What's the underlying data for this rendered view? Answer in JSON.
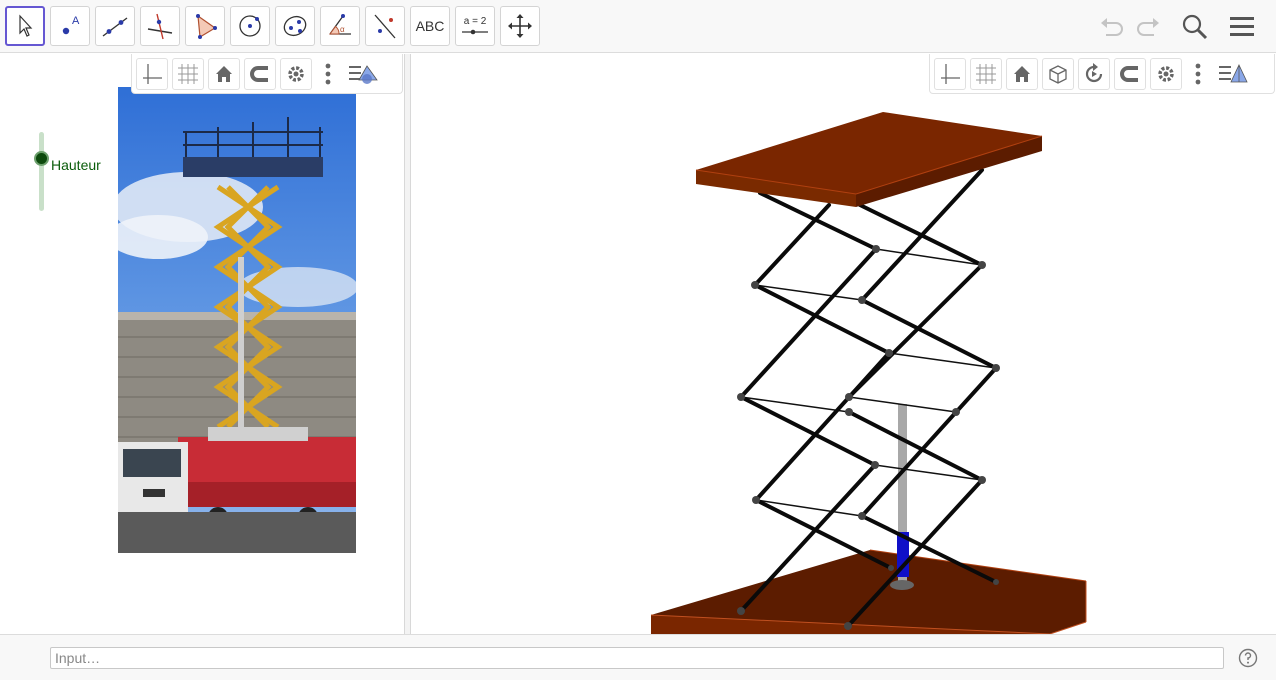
{
  "toolbar": {
    "tools": [
      {
        "name": "move-tool",
        "icon": "cursor-arrow-icon"
      },
      {
        "name": "point-tool",
        "icon": "point-icon",
        "glyph": "A"
      },
      {
        "name": "line-tool",
        "icon": "line-icon"
      },
      {
        "name": "perpendicular-tool",
        "icon": "perpendicular-icon"
      },
      {
        "name": "polygon-tool",
        "icon": "triangle-icon"
      },
      {
        "name": "circle-tool",
        "icon": "circle-center-icon"
      },
      {
        "name": "conic-tool",
        "icon": "ellipse-icon"
      },
      {
        "name": "angle-tool",
        "icon": "angle-icon",
        "glyph": "α"
      },
      {
        "name": "reflect-tool",
        "icon": "reflect-icon"
      },
      {
        "name": "text-tool",
        "icon": "text-icon",
        "label": "ABC"
      },
      {
        "name": "slider-tool",
        "icon": "slider-icon",
        "label": "a = 2"
      },
      {
        "name": "move-view-tool",
        "icon": "move-arrows-icon"
      }
    ],
    "right": [
      "undo-icon",
      "redo-icon",
      "search-icon",
      "menu-icon"
    ]
  },
  "algebra_view": {
    "slider": {
      "label": "Hauteur",
      "value": 0.67
    },
    "style_bar": [
      "axes-icon",
      "grid-icon",
      "home-icon",
      "magnet-icon",
      "gear-icon",
      "more-icon",
      "view-toggle-icon"
    ]
  },
  "graphics_3d": {
    "style_bar": [
      "axes-icon",
      "grid-icon",
      "home-icon",
      "cube-view-icon",
      "rotate-icon",
      "magnet-icon",
      "gear-icon",
      "more-icon",
      "view-toggle-icon"
    ]
  },
  "input_bar": {
    "placeholder": "Input…"
  },
  "colors": {
    "platform": "#7a2600",
    "accent": "#6557d2",
    "slider": "#0a5c0a"
  }
}
